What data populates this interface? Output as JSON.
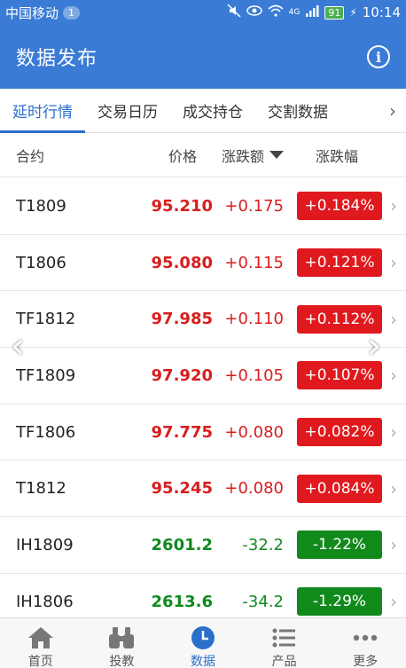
{
  "status": {
    "carrier": "中国移动",
    "notif_count": "1",
    "network": "4G",
    "battery": "91",
    "time": "10:14"
  },
  "appbar": {
    "title": "数据发布",
    "info_icon": "info-icon"
  },
  "tabs": [
    {
      "label": "延时行情",
      "active": true
    },
    {
      "label": "交易日历",
      "active": false
    },
    {
      "label": "成交持仓",
      "active": false
    },
    {
      "label": "交割数据",
      "active": false
    }
  ],
  "columns": {
    "contract": "合约",
    "price": "价格",
    "change": "涨跌额",
    "pct": "涨跌幅"
  },
  "rows": [
    {
      "symbol": "T1809",
      "price": "95.210",
      "change": "+0.175",
      "pct": "+0.184%",
      "dir": "up"
    },
    {
      "symbol": "T1806",
      "price": "95.080",
      "change": "+0.115",
      "pct": "+0.121%",
      "dir": "up"
    },
    {
      "symbol": "TF1812",
      "price": "97.985",
      "change": "+0.110",
      "pct": "+0.112%",
      "dir": "up"
    },
    {
      "symbol": "TF1809",
      "price": "97.920",
      "change": "+0.105",
      "pct": "+0.107%",
      "dir": "up"
    },
    {
      "symbol": "TF1806",
      "price": "97.775",
      "change": "+0.080",
      "pct": "+0.082%",
      "dir": "up"
    },
    {
      "symbol": "T1812",
      "price": "95.245",
      "change": "+0.080",
      "pct": "+0.084%",
      "dir": "up"
    },
    {
      "symbol": "IH1809",
      "price": "2601.2",
      "change": "-32.2",
      "pct": "-1.22%",
      "dir": "down"
    },
    {
      "symbol": "IH1806",
      "price": "2613.6",
      "change": "-34.2",
      "pct": "-1.29%",
      "dir": "down"
    }
  ],
  "bottom_nav": [
    {
      "label": "首页",
      "icon": "home-icon",
      "active": false
    },
    {
      "label": "投教",
      "icon": "binoculars-icon",
      "active": false
    },
    {
      "label": "数据",
      "icon": "clock-icon",
      "active": true
    },
    {
      "label": "产品",
      "icon": "list-icon",
      "active": false
    },
    {
      "label": "更多",
      "icon": "more-icon",
      "active": false
    }
  ],
  "colors": {
    "primary": "#3a7bd5",
    "up": "#e0191e",
    "down": "#118a1c",
    "tab_active": "#2a6fcb"
  }
}
